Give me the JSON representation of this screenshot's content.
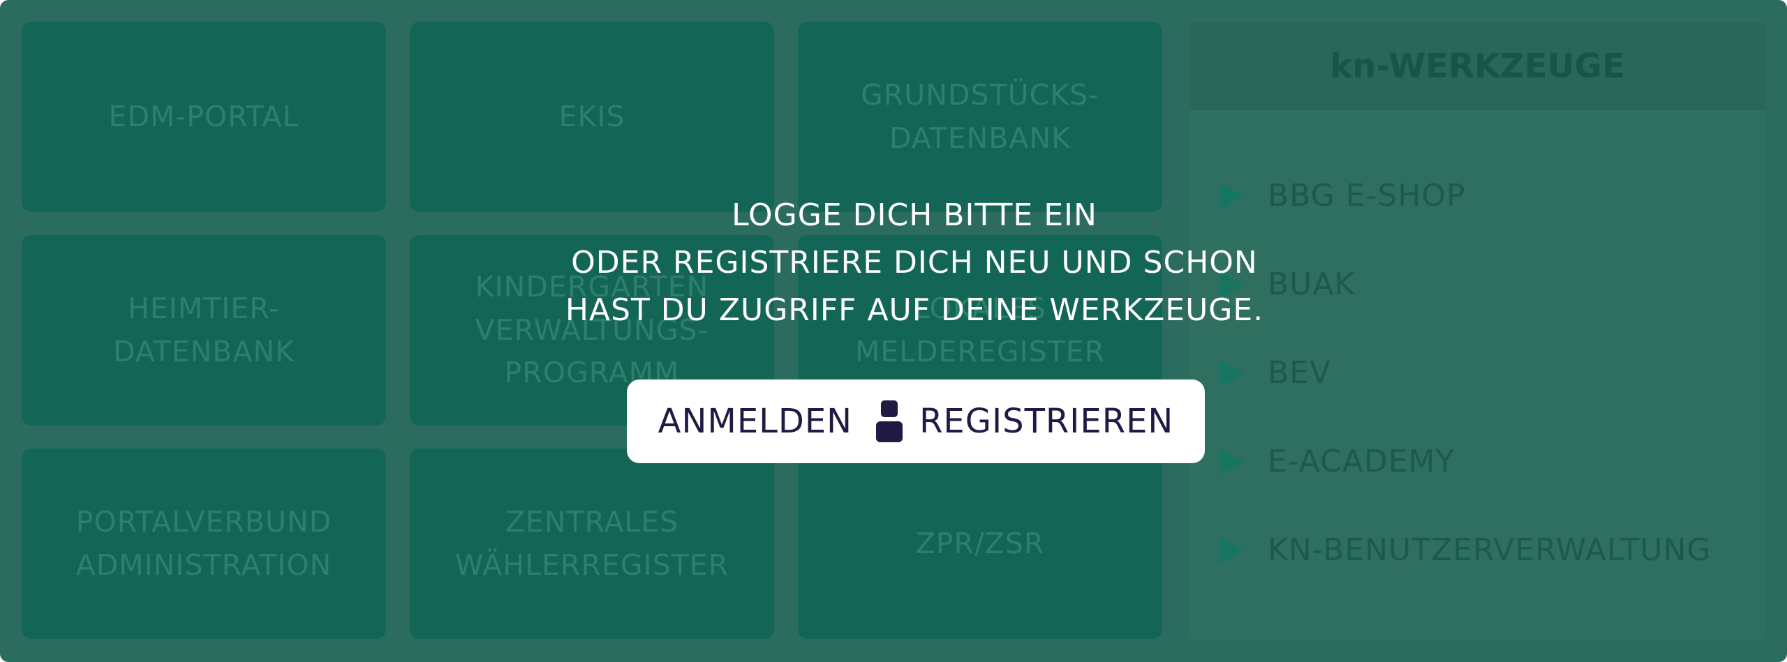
{
  "tiles": [
    {
      "label": "EDM-PORTAL"
    },
    {
      "label": "EKIS"
    },
    {
      "label": "GRUNDSTÜCKS-\nDATENBANK"
    },
    {
      "label": "HEIMTIER-\nDATENBANK"
    },
    {
      "label": "KINDERGARTEN\nVERWALTUNGS-\nPROGRAMM"
    },
    {
      "label": "LOKALES\nMELDEREGISTER"
    },
    {
      "label": "PORTALVERBUND\nADMINISTRATION"
    },
    {
      "label": "ZENTRALES\nWÄHLERREGISTER"
    },
    {
      "label": "ZPR/ZSR"
    }
  ],
  "tools": {
    "title": "kn-WERKZEUGE",
    "items": [
      {
        "label": "BBG E-SHOP"
      },
      {
        "label": "BUAK"
      },
      {
        "label": "BEV"
      },
      {
        "label": "E-ACADEMY"
      },
      {
        "label": "KN-BENUTZERVERWALTUNG"
      }
    ]
  },
  "overlay": {
    "lines": [
      "LOGGE DICH BITTE EIN",
      "ODER REGISTRIERE DICH NEU UND SCHON",
      "HAST DU ZUGRIFF AUF DEINE WERKZEUGE."
    ],
    "login_label": "ANMELDEN",
    "register_label": "REGISTRIEREN"
  }
}
